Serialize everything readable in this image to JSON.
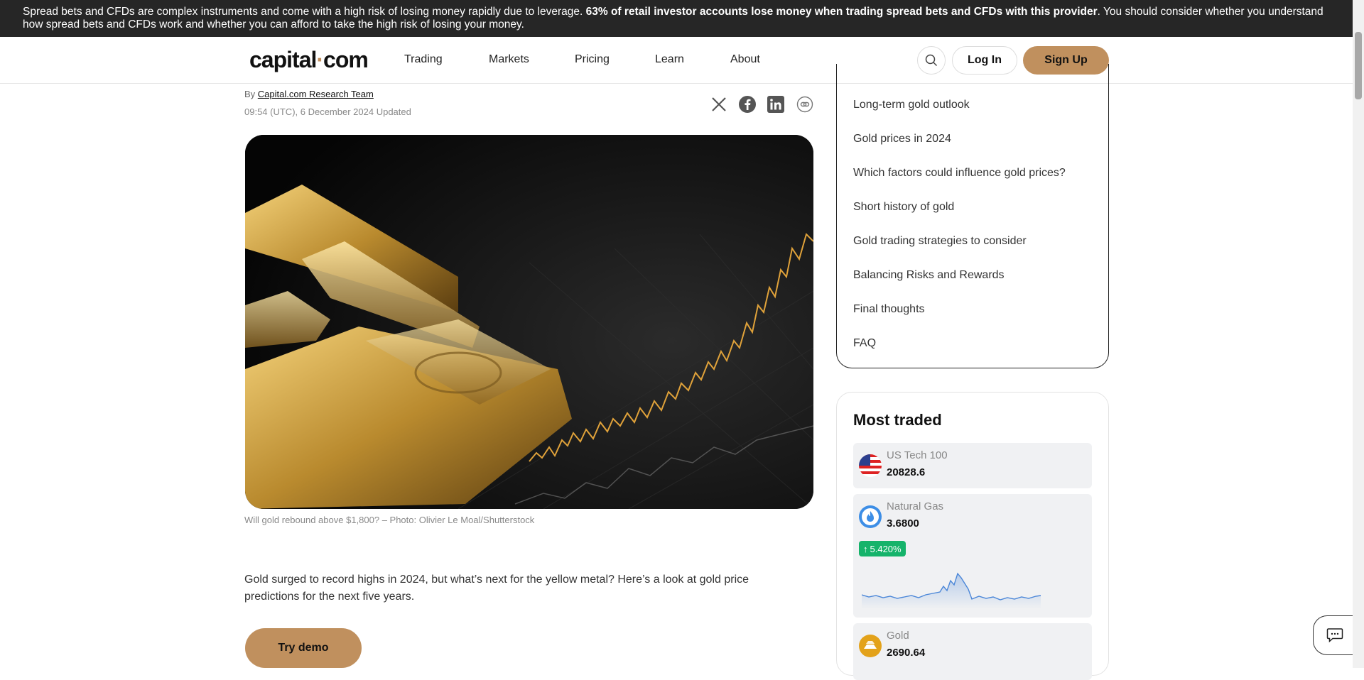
{
  "risk_warning": {
    "text_start": "Spread bets and CFDs are complex instruments and come with a high risk of losing money rapidly due to leverage. ",
    "text_bold": "63% of retail investor accounts lose money when trading spread bets and CFDs with this provider",
    "text_end": ". You should consider whether you understand how spread bets and CFDs work and whether you can afford to take the high risk of losing your money."
  },
  "header": {
    "logo_left": "capital",
    "logo_dot": "·",
    "logo_right": "com",
    "nav": [
      "Trading",
      "Markets",
      "Pricing",
      "Learn",
      "About"
    ],
    "login_label": "Log In",
    "signup_label": "Sign Up",
    "search_icon": "search-icon"
  },
  "article": {
    "by_prefix": "By ",
    "author": "Capital.com Research Team",
    "date": "09:54 (UTC), 6 December 2024 Updated",
    "share_icons": [
      "x-icon",
      "facebook-icon",
      "linkedin-icon",
      "copy-link-icon"
    ],
    "image_caption": "Will gold rebound above $1,800? – Photo: Olivier Le Moal/Shutterstock",
    "intro": "Gold surged to record highs in 2024, but what’s next for the yellow metal? Here’s a look at gold price predictions for the next five years.",
    "demo_label": "Try demo"
  },
  "toc": {
    "items": [
      "Long-term gold outlook",
      "Gold prices in 2024",
      "Which factors could influence gold prices?",
      "Short history of gold",
      "Gold trading strategies to consider",
      "Balancing Risks and Rewards",
      "Final thoughts",
      "FAQ"
    ]
  },
  "most_traded": {
    "title": "Most traded",
    "instruments": [
      {
        "name": "US Tech 100",
        "price": "20828.6",
        "icon": "us-flag-icon"
      },
      {
        "name": "Natural Gas",
        "price": "3.6800",
        "icon": "flame-icon",
        "change": "5.420%"
      },
      {
        "name": "Gold",
        "price": "2690.64",
        "icon": "gold-bars-icon"
      }
    ]
  },
  "colors": {
    "accent": "#c0905e",
    "dark_bar": "#262626",
    "positive": "#15b36a",
    "sparkline": "#4a86d8"
  },
  "widgets": {
    "chat_icon": "chat-icon"
  }
}
